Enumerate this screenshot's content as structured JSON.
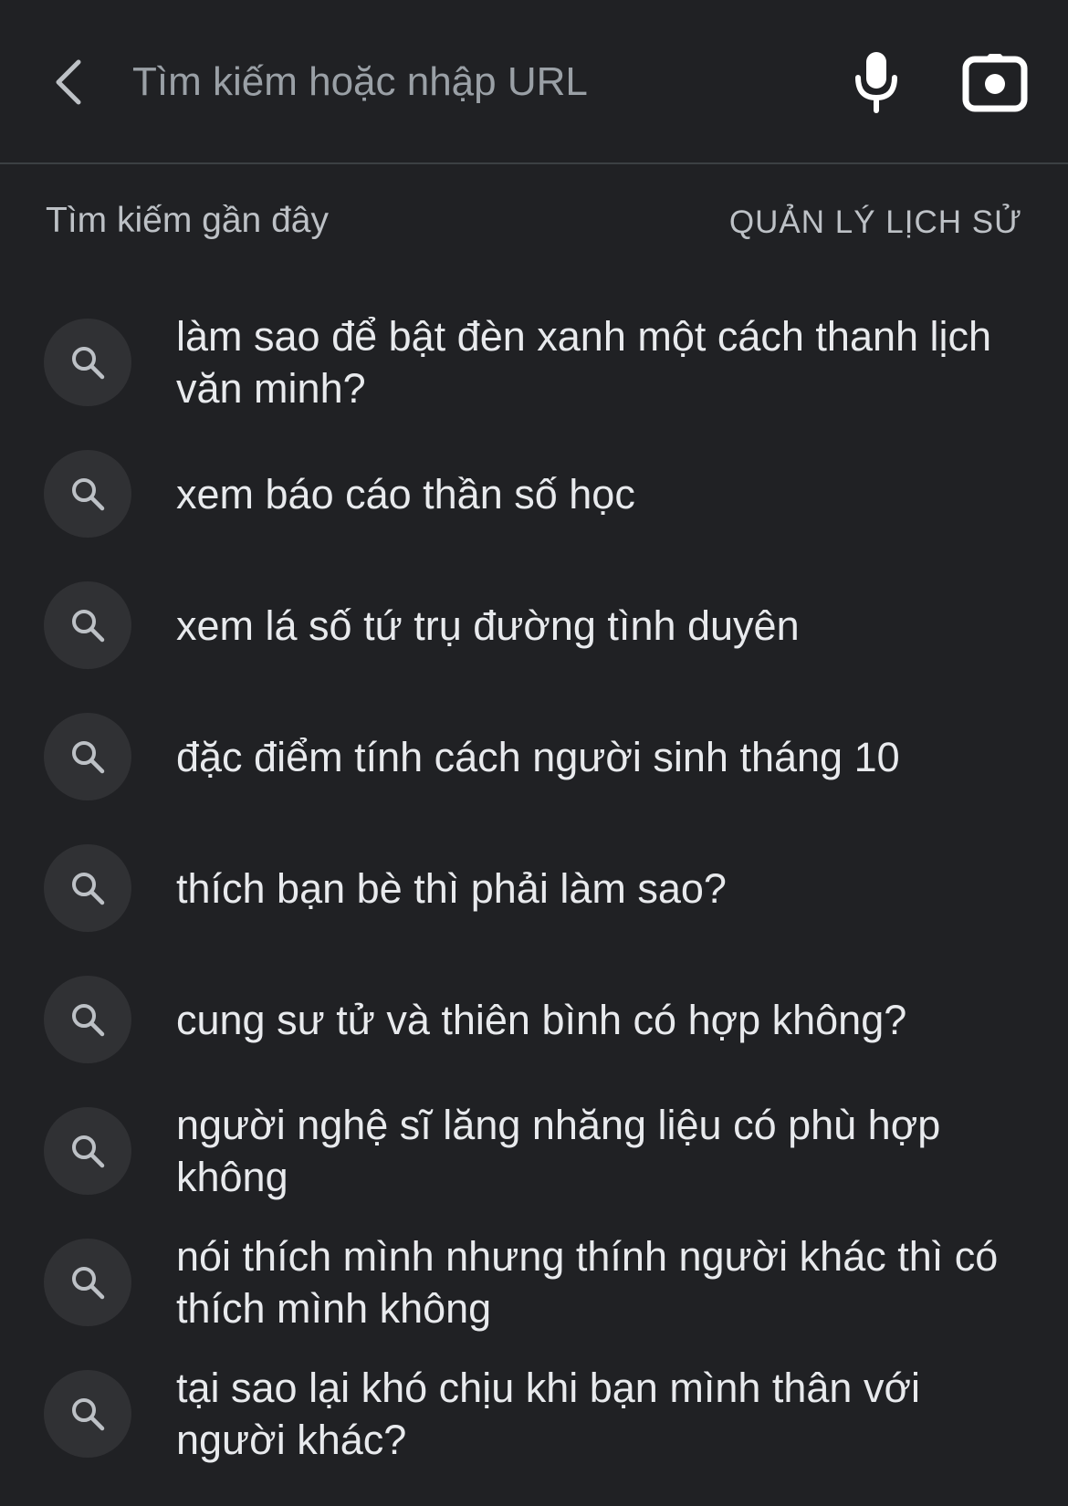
{
  "search": {
    "placeholder": "Tìm kiếm hoặc nhập URL"
  },
  "header": {
    "icons": [
      "back-arrow-icon",
      "microphone-icon",
      "camera-icon"
    ]
  },
  "recent": {
    "title": "Tìm kiếm gần đây",
    "manage_label": "QUẢN LÝ LỊCH SỬ",
    "items": [
      {
        "icon": "search-icon",
        "text": "làm sao để bật đèn xanh một cách thanh lịch văn minh?"
      },
      {
        "icon": "search-icon",
        "text": "xem báo cáo thần số học"
      },
      {
        "icon": "search-icon",
        "text": "xem lá số tứ trụ đường tình duyên"
      },
      {
        "icon": "search-icon",
        "text": "đặc điểm tính cách người sinh tháng 10"
      },
      {
        "icon": "search-icon",
        "text": "thích bạn bè thì phải làm sao?"
      },
      {
        "icon": "search-icon",
        "text": "cung sư tử và thiên bình có hợp không?"
      },
      {
        "icon": "search-icon",
        "text": "người nghệ sĩ lăng nhăng liệu có phù hợp không"
      },
      {
        "icon": "search-icon",
        "text": "nói thích mình nhưng thính người khác thì có thích mình không"
      },
      {
        "icon": "search-icon",
        "text": "tại sao lại khó chịu khi bạn mình thân với người khác?"
      }
    ]
  },
  "colors": {
    "background": "#202124",
    "text": "#e8eaed",
    "muted": "#9aa0a6",
    "icon_circle": "#303134"
  }
}
